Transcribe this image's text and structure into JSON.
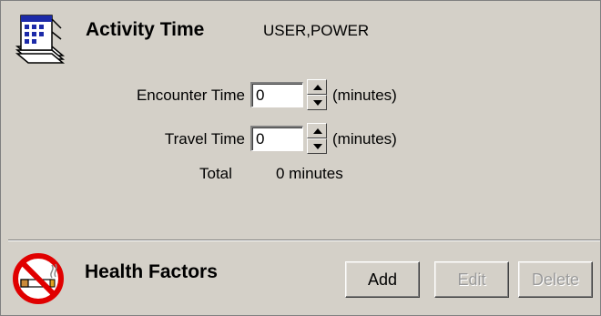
{
  "activity": {
    "title": "Activity Time",
    "user": "USER,POWER",
    "icon": "calendar-book-icon",
    "encounter": {
      "label": "Encounter Time",
      "value": "0",
      "units": "(minutes)"
    },
    "travel": {
      "label": "Travel Time",
      "value": "0",
      "units": "(minutes)"
    },
    "total": {
      "label": "Total",
      "value": "0 minutes"
    }
  },
  "health": {
    "title": "Health Factors",
    "icon": "no-smoking-icon",
    "buttons": {
      "add": "Add",
      "edit": "Edit",
      "delete": "Delete"
    }
  },
  "colors": {
    "background": "#d4d0c8",
    "no_smoking_red": "#e00000",
    "disabled_text": "#9a9a9a"
  }
}
